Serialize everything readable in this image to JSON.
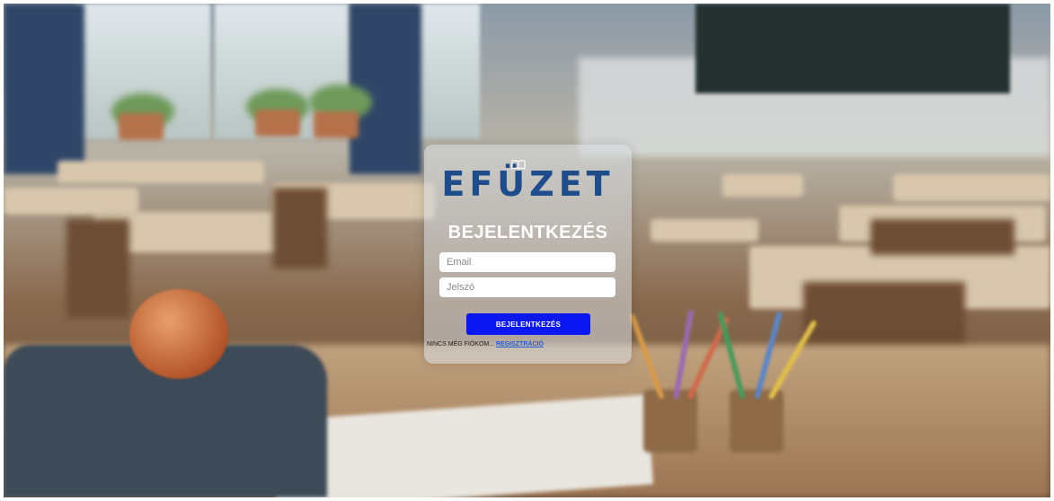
{
  "app": {
    "logo_text": "EFÜZET"
  },
  "login": {
    "title": "BEJELENTKEZÉS",
    "email_placeholder": "Email",
    "password_placeholder": "Jelszó",
    "submit_label": "BEJELENTKEZÉS",
    "no_account_text": "NINCS MÉG FIÓKOM...",
    "register_link": "REGISZTRÁCIÓ"
  },
  "colors": {
    "logo": "#1f4c8a",
    "button": "#0a17f0",
    "title": "#ffffff"
  },
  "icons": {
    "logo_icon": "book-icon"
  }
}
